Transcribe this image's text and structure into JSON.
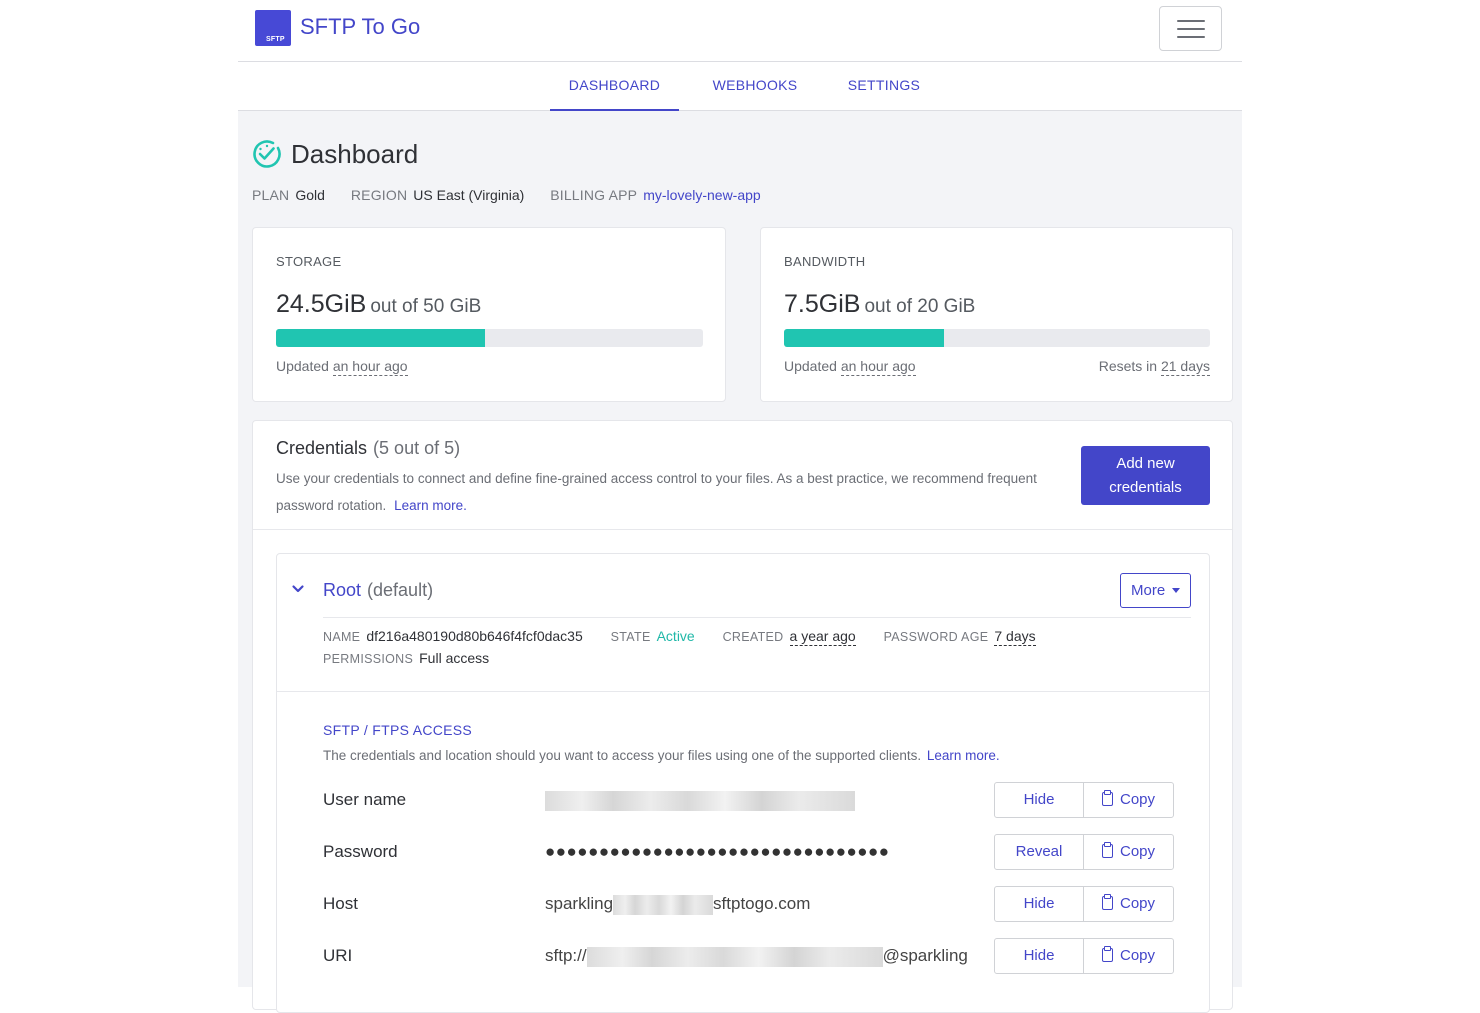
{
  "app": {
    "brand": "SFTP To Go",
    "logo_text": "SFTP"
  },
  "tabs": [
    {
      "label": "DASHBOARD",
      "active": true
    },
    {
      "label": "WEBHOOKS",
      "active": false
    },
    {
      "label": "SETTINGS",
      "active": false
    }
  ],
  "page": {
    "title": "Dashboard",
    "icon": "speedometer-check-icon",
    "plan_label": "PLAN",
    "plan": "Gold",
    "region_label": "REGION",
    "region": "US East (Virginia)",
    "billing_label": "BILLING APP",
    "billing_app": "my-lovely-new-app"
  },
  "storage": {
    "label": "STORAGE",
    "used": "24.5GiB",
    "total": "out of 50 GiB",
    "percent": 49,
    "updated_prefix": "Updated",
    "updated": "an hour ago"
  },
  "bandwidth": {
    "label": "BANDWIDTH",
    "used": "7.5GiB",
    "total": "out of 20 GiB",
    "percent": 37.5,
    "updated_prefix": "Updated",
    "updated": "an hour ago",
    "resets_prefix": "Resets in",
    "resets": "21 days"
  },
  "credentials": {
    "title": "Credentials",
    "count": "(5 out of 5)",
    "description": "Use your credentials to connect and define fine-grained access control to your files. As a best practice, we recommend frequent password rotation.",
    "learn_more": "Learn more.",
    "add_button": "Add new credentials"
  },
  "root": {
    "title": "Root",
    "tag": "(default)",
    "more_button": "More",
    "name_label": "NAME",
    "name": "df216a480190d80b646f4fcf0dac35",
    "state_label": "STATE",
    "state": "Active",
    "created_label": "CREATED",
    "created": "a year ago",
    "password_age_label": "PASSWORD AGE",
    "password_age": "7 days",
    "permissions_label": "PERMISSIONS",
    "permissions": "Full access"
  },
  "access": {
    "section_label": "SFTP / FTPS ACCESS",
    "description": "The credentials and location should you want to access your files using one of the supported clients.",
    "learn_more": "Learn more.",
    "fields": [
      {
        "label": "User name",
        "value": "",
        "action": "Hide",
        "copy": "Copy"
      },
      {
        "label": "Password",
        "value": "●●●●●●●●●●●●●●●●●●●●●●●●●●●●●●●●",
        "action": "Reveal",
        "copy": "Copy"
      },
      {
        "label": "Host",
        "value_prefix": "sparkling",
        "value_suffix": "sftptogo.com",
        "action": "Hide",
        "copy": "Copy"
      },
      {
        "label": "URI",
        "value_prefix": "sftp://",
        "value_suffix": "@sparkling",
        "action": "Hide",
        "copy": "Copy"
      }
    ]
  },
  "colors": {
    "accent": "#4346c9",
    "teal": "#20c5b1",
    "background": "#f3f4f7"
  }
}
